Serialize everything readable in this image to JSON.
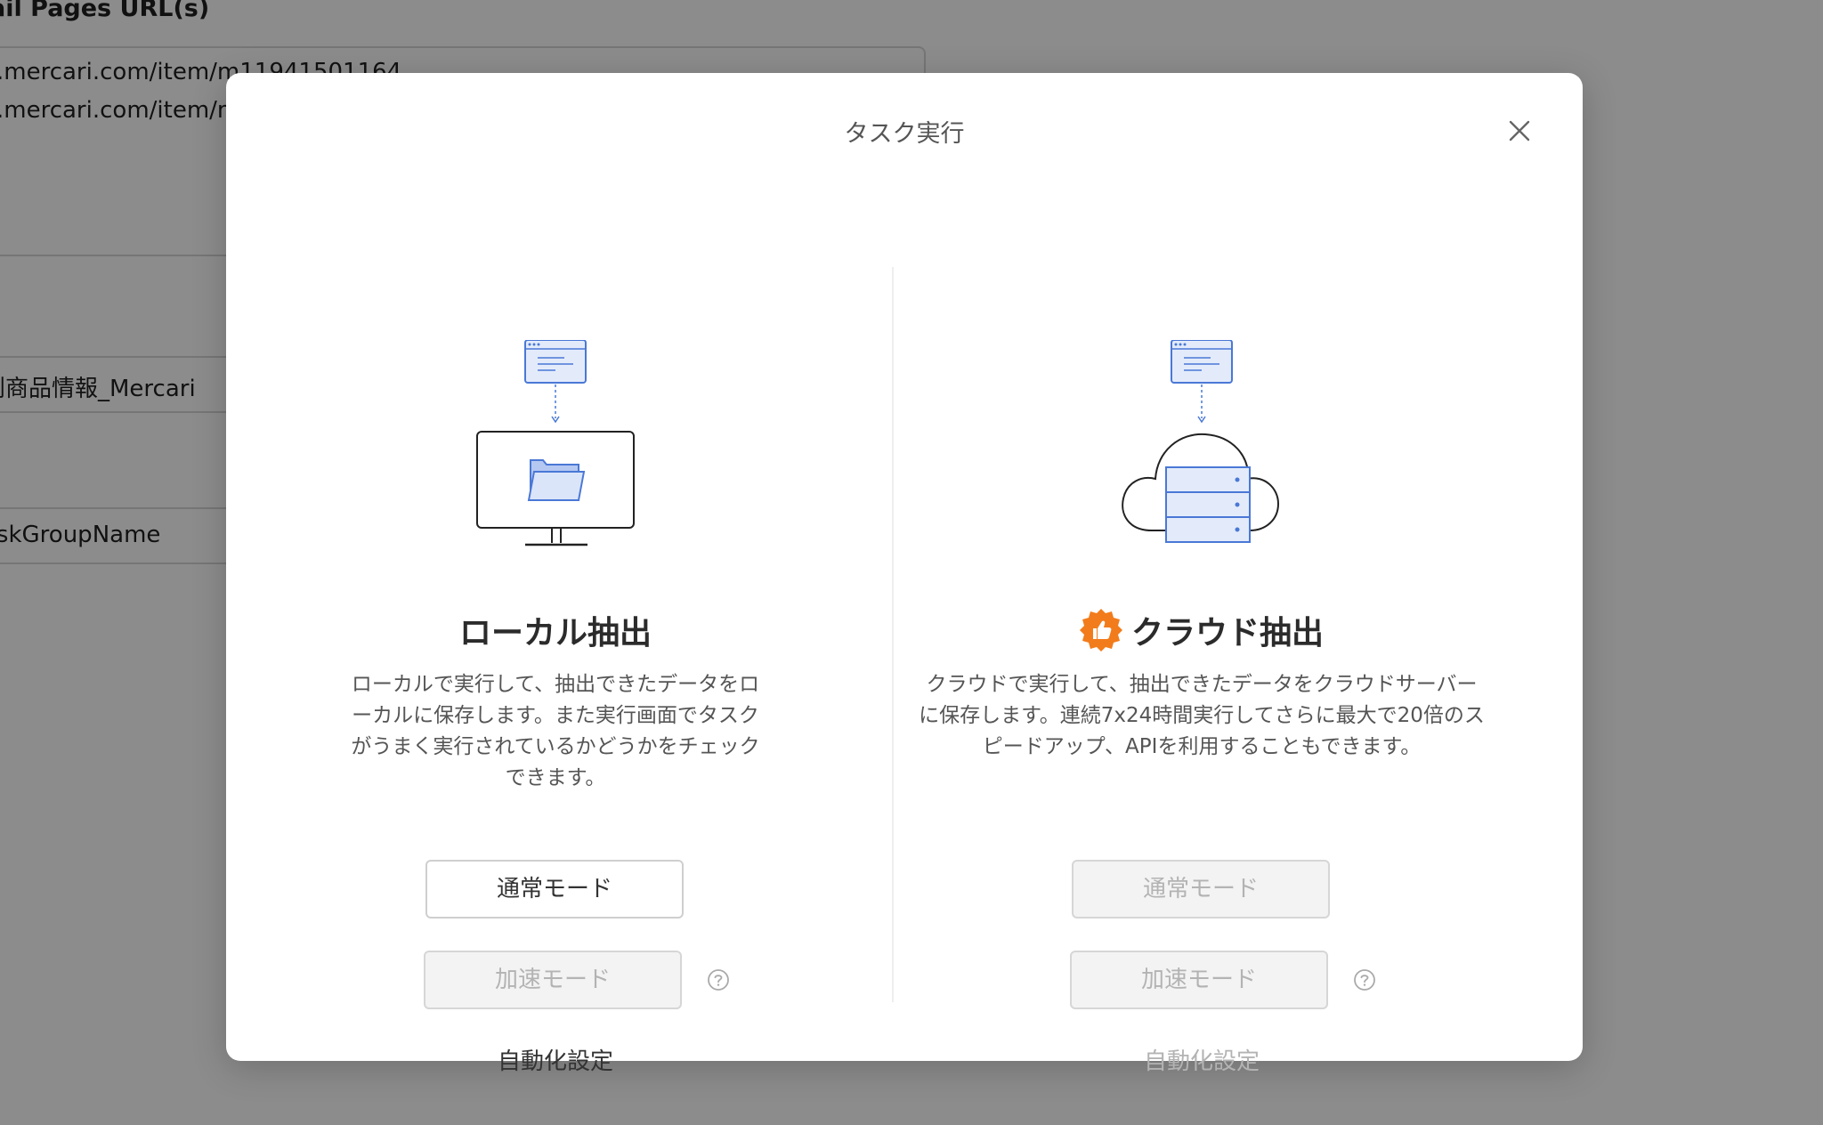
{
  "background": {
    "field_label": "ail Pages URL(s)",
    "urls": [
      ".mercari.com/item/m11941501164",
      ".mercari.com/item/m"
    ],
    "row1_text": "別商品情報_Mercari",
    "row2_text": "askGroupName"
  },
  "modal": {
    "title": "タスク実行",
    "close_icon": "close-icon",
    "local": {
      "title": "ローカル抽出",
      "description": "ローカルで実行して、抽出できたデータをローカルに保存します。また実行画面でタスクがうまく実行されているかどうかをチェックできます。",
      "normal_mode": "通常モード",
      "fast_mode": "加速モード",
      "automation": "自動化設定"
    },
    "cloud": {
      "title": "クラウド抽出",
      "badge_icon": "thumbs-up-badge-icon",
      "badge_color": "#f27c1b",
      "description": "クラウドで実行して、抽出できたデータをクラウドサーバーに保存します。連続7x24時間実行してさらに最大で20倍のスピードアップ、APIを利用することもできます。",
      "normal_mode": "通常モード",
      "fast_mode": "加速モード",
      "automation": "自動化設定"
    }
  },
  "colors": {
    "accent_blue": "#4a78d6",
    "badge_orange": "#f27c1b"
  }
}
